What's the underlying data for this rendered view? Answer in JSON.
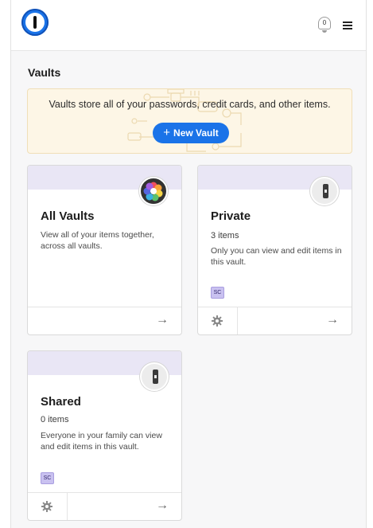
{
  "header": {
    "app_logo": "1password-logo-icon",
    "notifications": {
      "icon": "bell-icon",
      "count": "0"
    },
    "menu_icon": "hamburger-menu-icon"
  },
  "page": {
    "title": "Vaults"
  },
  "banner": {
    "text": "Vaults store all of your passwords, credit cards, and other items.",
    "button_label": "New Vault",
    "button_icon": "plus-icon"
  },
  "vaults": [
    {
      "title": "All Vaults",
      "description": "View all of your items together, across all vaults.",
      "icon": "multi-vault-icon"
    },
    {
      "title": "Private",
      "count": "3 items",
      "description": "Only you can view and edit items in this vault.",
      "member_initials": "SC",
      "icon": "lock-vault-icon"
    },
    {
      "title": "Shared",
      "count": "0 items",
      "description": "Everyone in your family can view and edit items in this vault.",
      "member_initials": "SC",
      "icon": "lock-vault-icon"
    }
  ],
  "colors": {
    "accent": "#1a73e8",
    "banner_bg": "#fdf6e6",
    "card_header": "#e9e6f5",
    "avatar_bg": "#c9c1f0"
  }
}
